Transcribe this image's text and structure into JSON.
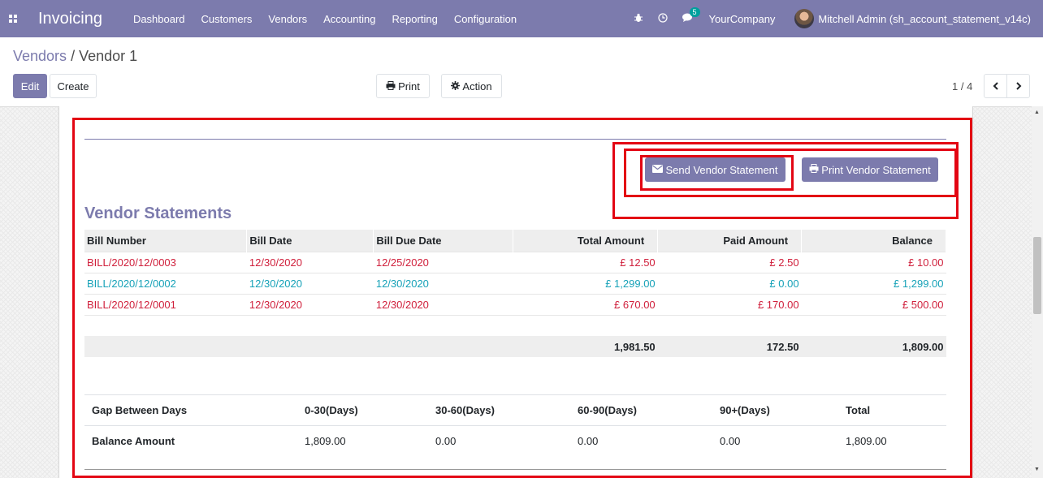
{
  "navbar": {
    "brand": "Invoicing",
    "menu": [
      "Dashboard",
      "Customers",
      "Vendors",
      "Accounting",
      "Reporting",
      "Configuration"
    ],
    "message_count": "5",
    "company": "YourCompany",
    "user": "Mitchell Admin (sh_account_statement_v14c)"
  },
  "breadcrumb": {
    "parent": "Vendors",
    "separator": " / ",
    "current": "Vendor 1"
  },
  "toolbar": {
    "edit": "Edit",
    "create": "Create",
    "print": "Print",
    "action": "Action"
  },
  "pager": {
    "value": "1 / 4"
  },
  "statement": {
    "send_button": "Send Vendor Statement",
    "print_button": "Print Vendor Statement",
    "title": "Vendor Statements",
    "headers": [
      "Bill Number",
      "Bill Date",
      "Bill Due Date",
      "Total Amount",
      "Paid Amount",
      "Balance"
    ],
    "rows": [
      {
        "number": "BILL/2020/12/0003",
        "date": "12/30/2020",
        "due": "12/25/2020",
        "total": "£ 12.50",
        "paid": "£ 2.50",
        "balance": "£ 10.00",
        "status": "red"
      },
      {
        "number": "BILL/2020/12/0002",
        "date": "12/30/2020",
        "due": "12/30/2020",
        "total": "£ 1,299.00",
        "paid": "£ 0.00",
        "balance": "£ 1,299.00",
        "status": "teal"
      },
      {
        "number": "BILL/2020/12/0001",
        "date": "12/30/2020",
        "due": "12/30/2020",
        "total": "£ 670.00",
        "paid": "£ 170.00",
        "balance": "£ 500.00",
        "status": "red"
      }
    ],
    "totals": {
      "total": "1,981.50",
      "paid": "172.50",
      "balance": "1,809.00"
    }
  },
  "aging": {
    "headers": [
      "Gap Between Days",
      "0-30(Days)",
      "30-60(Days)",
      "60-90(Days)",
      "90+(Days)",
      "Total"
    ],
    "row": [
      "Balance Amount",
      "1,809.00",
      "0.00",
      "0.00",
      "0.00",
      "1,809.00"
    ]
  },
  "colors": {
    "brand": "#7c7bad",
    "overdue": "#d0203c",
    "due": "#17a2b8",
    "highlight": "#e30613"
  }
}
